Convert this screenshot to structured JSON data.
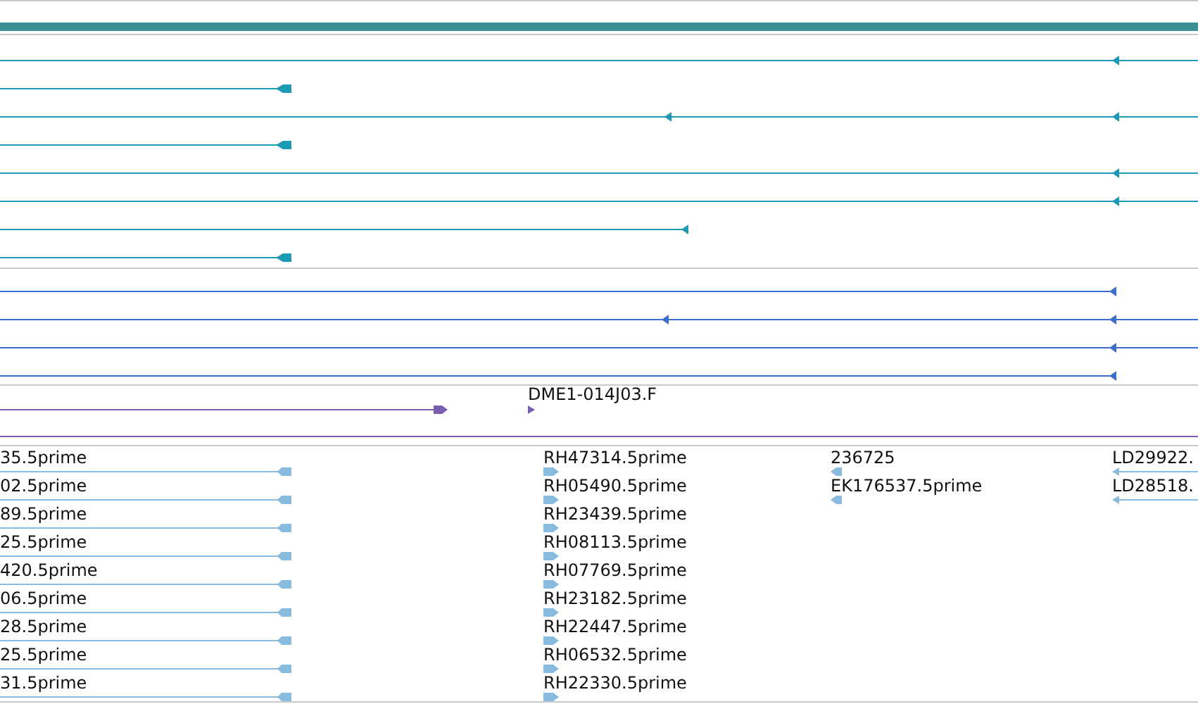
{
  "tracks": [
    {
      "kind": "bar",
      "color": "#3a9096"
    },
    {
      "kind": "features",
      "color": "#1a9ab5"
    },
    {
      "kind": "features",
      "color": "#3a6fd0"
    },
    {
      "kind": "labeled",
      "color": "#7a5fb0",
      "columns": [
        [
          "DME1-014J03.F"
        ]
      ]
    },
    {
      "kind": "labeled",
      "color": "#88bbdd",
      "columns": [
        [
          "35.5prime",
          "02.5prime",
          "89.5prime",
          "25.5prime",
          "420.5prime",
          "06.5prime",
          "28.5prime",
          "25.5prime",
          "31.5prime"
        ],
        [
          "RH47314.5prime",
          "RH05490.5prime",
          "RH23439.5prime",
          "RH08113.5prime",
          "RH07769.5prime",
          "RH23182.5prime",
          "RH22447.5prime",
          "RH06532.5prime",
          "RH22330.5prime"
        ],
        [
          "236725",
          "EK176537.5prime"
        ],
        [
          "LD29922.",
          "LD28518."
        ]
      ]
    }
  ]
}
